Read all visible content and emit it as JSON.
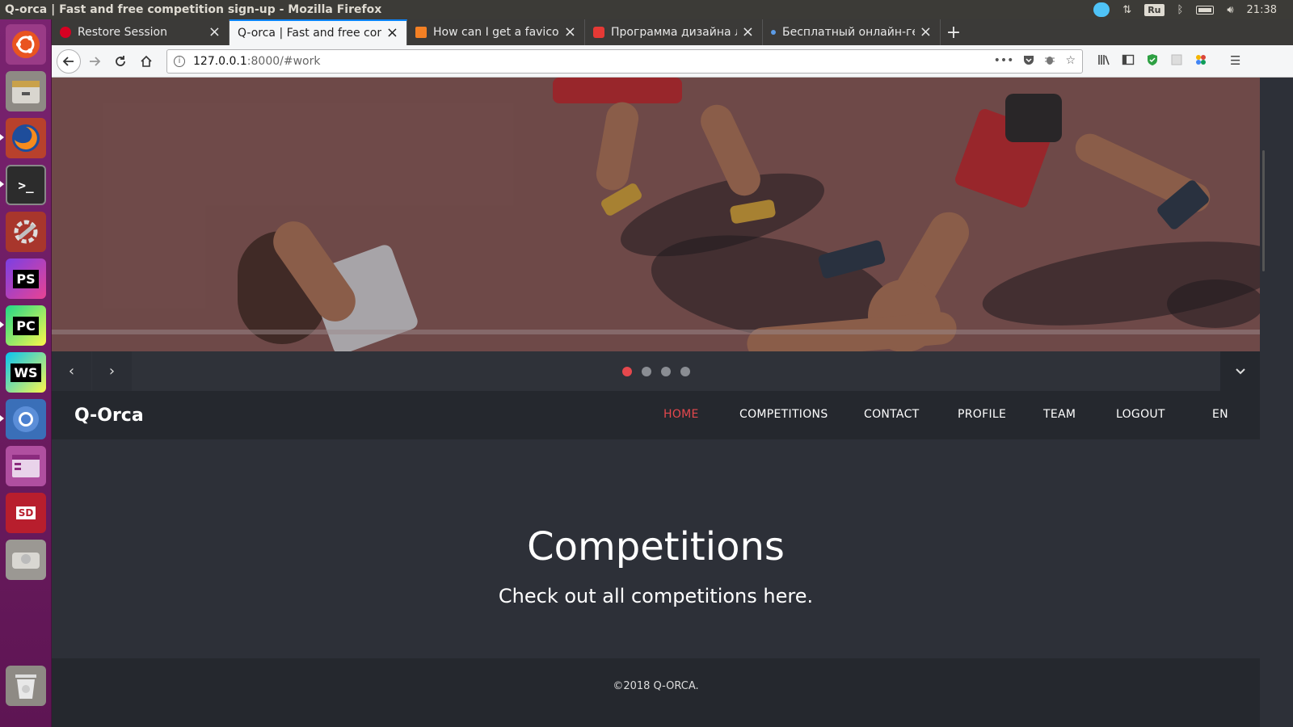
{
  "os": {
    "window_title": "Q-orca | Fast and free competition sign-up - Mozilla Firefox",
    "keyboard_layout": "Ru",
    "clock": "21:38",
    "launcher": [
      {
        "name": "ubuntu-dash-icon",
        "label": ""
      },
      {
        "name": "files-icon",
        "label": ""
      },
      {
        "name": "firefox-icon",
        "label": ""
      },
      {
        "name": "terminal-icon",
        "label": ">_"
      },
      {
        "name": "system-settings-icon",
        "label": ""
      },
      {
        "name": "phpstorm-icon",
        "label": "PS"
      },
      {
        "name": "pycharm-icon",
        "label": "PC"
      },
      {
        "name": "webstorm-icon",
        "label": "WS"
      },
      {
        "name": "chromium-icon",
        "label": ""
      },
      {
        "name": "app-window-icon",
        "label": ""
      },
      {
        "name": "sd-card-icon",
        "label": "SD"
      },
      {
        "name": "drive-icon",
        "label": ""
      },
      {
        "name": "trash-icon",
        "label": ""
      }
    ]
  },
  "browser": {
    "tabs": [
      {
        "title": "Restore Session",
        "icon_color": "#d70022",
        "active": false
      },
      {
        "title": "Q-orca | Fast and free comp",
        "icon_color": "",
        "active": true
      },
      {
        "title": "How can I get a favicon",
        "icon_color": "#f48024",
        "active": false
      },
      {
        "title": "Программа дизайна ло",
        "icon_color": "#e53935",
        "active": false
      },
      {
        "title": "Бесплатный онлайн-ге",
        "icon_color": "#5c9ce6",
        "active": false
      }
    ],
    "new_tab_label": "+",
    "url_host": "127.0.0.1",
    "url_rest": ":8000/#work",
    "url_actions": [
      "•••",
      "pocket",
      "bug",
      "☆"
    ]
  },
  "site": {
    "brand": "Q-Orca",
    "menu": [
      {
        "label": "HOME",
        "active": true
      },
      {
        "label": "COMPETITIONS",
        "active": false
      },
      {
        "label": "CONTACT",
        "active": false
      },
      {
        "label": "PROFILE",
        "active": false
      },
      {
        "label": "TEAM",
        "active": false
      },
      {
        "label": "LOGOUT",
        "active": false
      },
      {
        "label": "EN",
        "active": false
      }
    ],
    "slider": {
      "prev": "‹",
      "next": "›",
      "dots": 4,
      "active_dot": 0,
      "down": "⌄"
    },
    "section": {
      "title": "Competitions",
      "subtitle": "Check out all competitions here."
    },
    "footer": "©2018 Q-ORCA."
  },
  "colors": {
    "accent": "#e5484d",
    "page_bg": "#2d3038",
    "nav_bg": "#25282e",
    "launcher_bg": "#6d1e5e"
  }
}
